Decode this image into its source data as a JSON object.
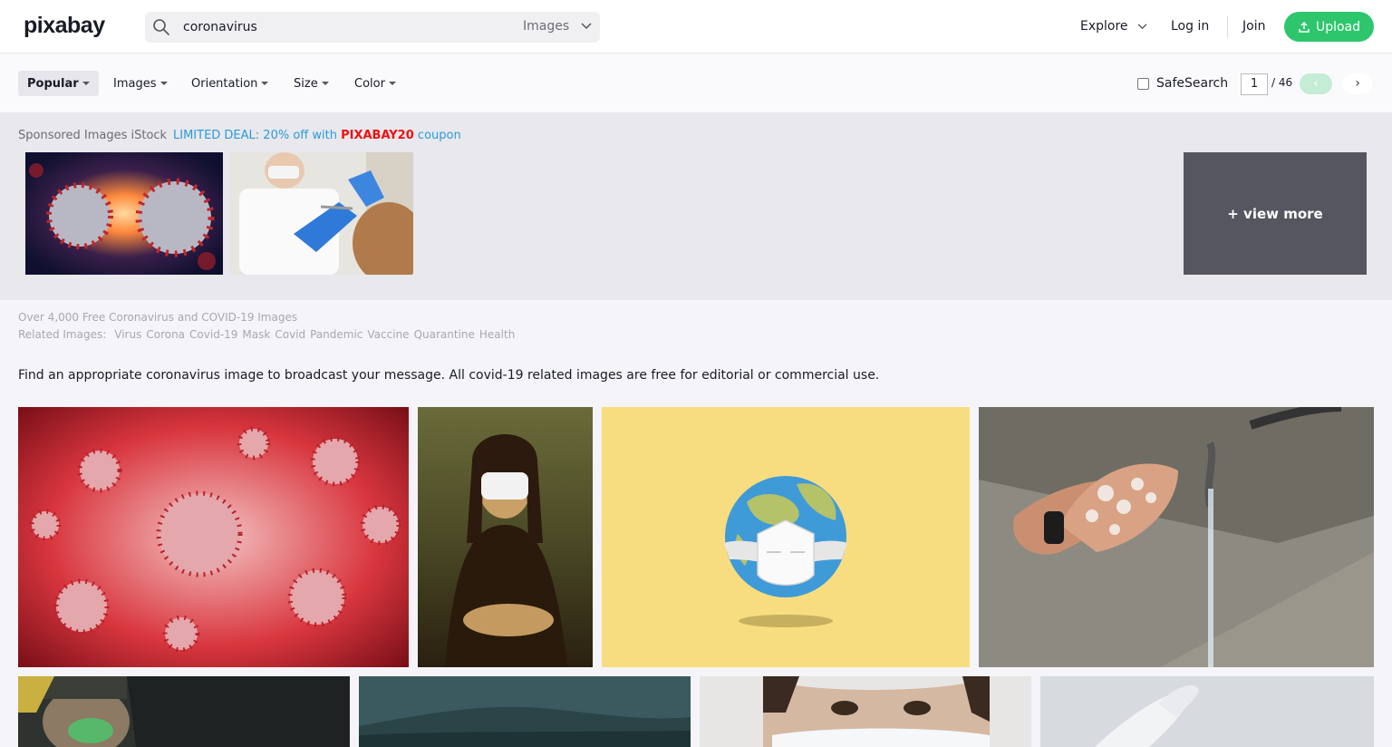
{
  "header": {
    "logo": "pixabay",
    "search_value": "coronavirus",
    "search_type": "Images",
    "explore": "Explore",
    "login": "Log in",
    "join": "Join",
    "upload": "Upload"
  },
  "filters": {
    "popular": "Popular",
    "images": "Images",
    "orientation": "Orientation",
    "size": "Size",
    "color": "Color",
    "safesearch": "SafeSearch",
    "page": "1",
    "page_total": "/ 46",
    "prev": "‹",
    "next": "›"
  },
  "sponsored": {
    "label": "Sponsored Images iStock",
    "deal_prefix": "LIMITED DEAL: 20% off with",
    "coupon": "PIXABAY20",
    "deal_suffix": "coupon",
    "view_more": "+ view more"
  },
  "info": {
    "title": "Over 4,000 Free Coronavirus and COVID-19 Images",
    "related_label": "Related Images:",
    "related": [
      "Virus",
      "Corona",
      "Covid-19",
      "Mask",
      "Covid",
      "Pandemic",
      "Vaccine",
      "Quarantine",
      "Health"
    ],
    "description": "Find an appropriate coronavirus image to broadcast your message. All covid-19 related images are free for editorial or commercial use."
  },
  "colors": {
    "accent": "#2ec66d",
    "link": "#2a9bd8",
    "coupon": "#ee1111"
  }
}
